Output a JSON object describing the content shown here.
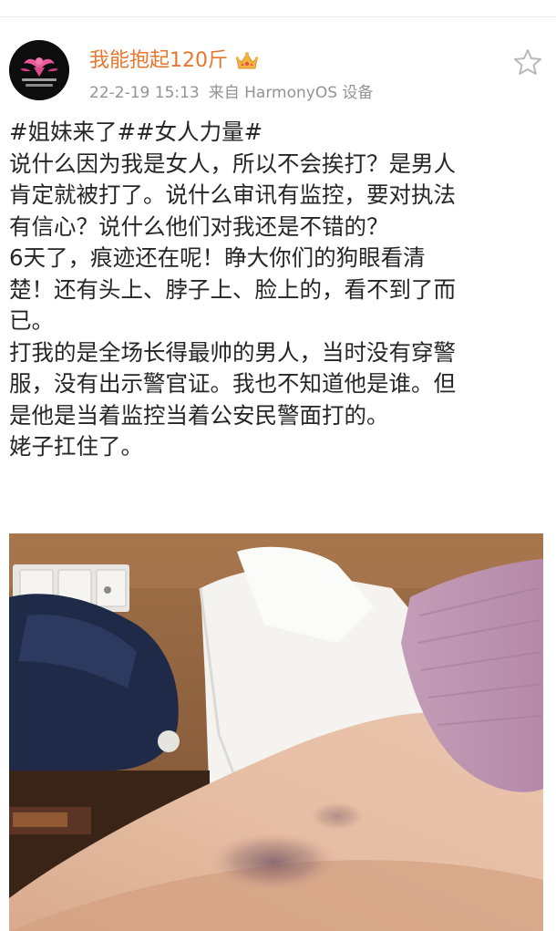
{
  "user": {
    "name": "我能抱起120斤",
    "avatar_icon": "girl-power-logo-avatar",
    "badge_icon": "crown-icon"
  },
  "meta": {
    "time": "22-2-19 15:13",
    "source": "来自 HarmonyOS 设备"
  },
  "post": {
    "lines": [
      "#姐妹来了##女人力量#",
      "说什么因为我是女人，所以不会挨打？是男人",
      "肯定就被打了。说什么审讯有监控，要对执法",
      "有信心？说什么他们对我还是不错的？",
      "6天了，痕迹还在呢！睁大你们的狗眼看清",
      "楚！还有头上、脖子上、脸上的，看不到了而",
      "已。",
      "打我的是全场长得最帅的男人，当时没有穿警",
      "服，没有出示警官证。我也不知道他是谁。但",
      "是他是当着监控当着公安民警面打的。",
      "姥子扛住了。"
    ]
  },
  "actions": {
    "favorite_icon": "star-outline-icon"
  },
  "photo": {
    "subject": "arm-bruise-photo"
  },
  "colors": {
    "username": "#e8762d",
    "meta": "#939393",
    "body_text": "#262626",
    "star": "#b8b8b8"
  }
}
